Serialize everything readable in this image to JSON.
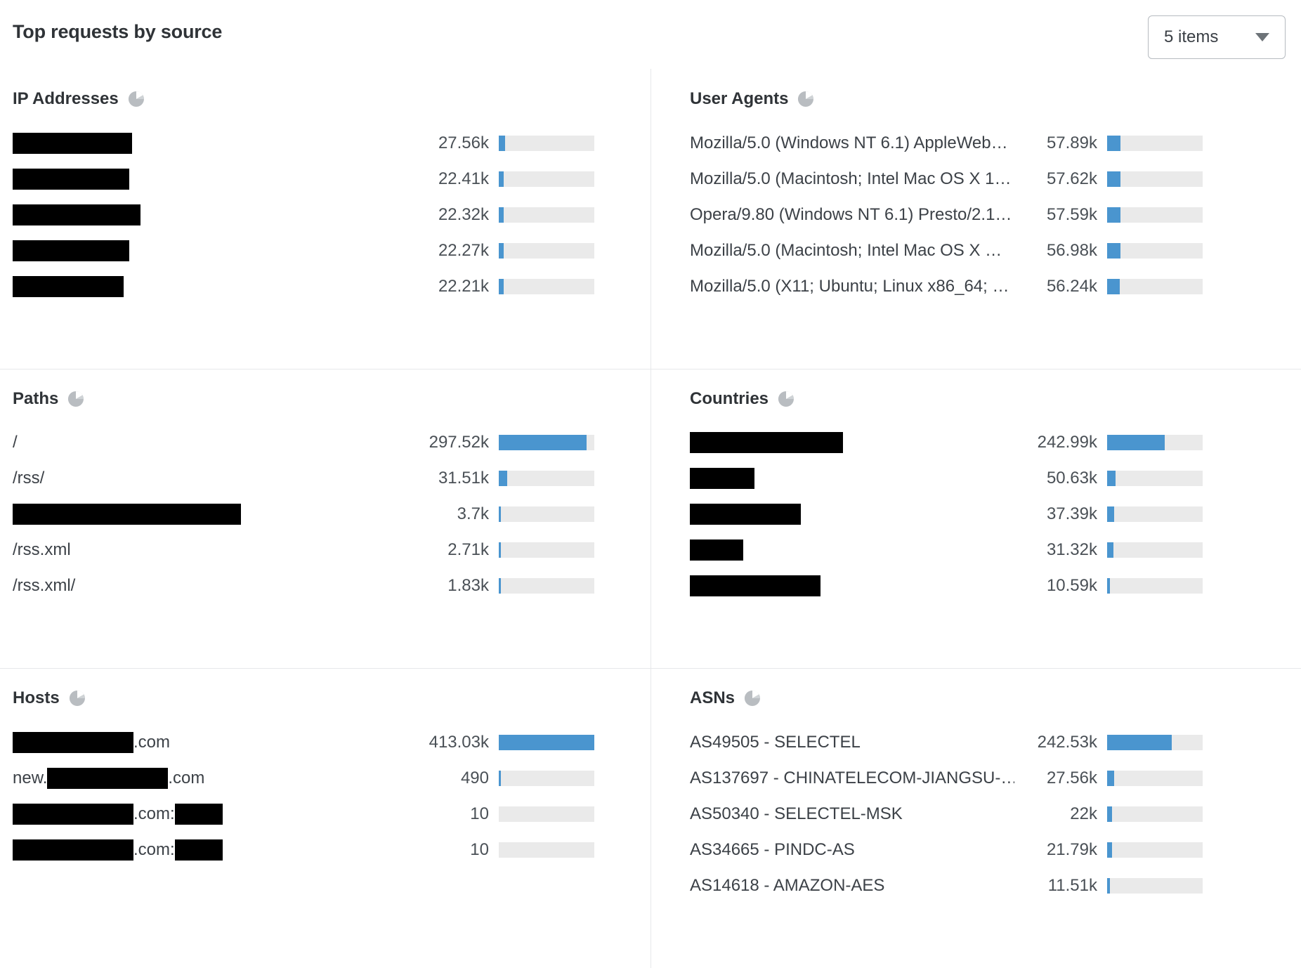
{
  "card": {
    "title": "Top requests by source",
    "items_select": {
      "value": "5 items",
      "caret_icon": "chevron-down-icon"
    }
  },
  "icons": {
    "section": "pie-chart-icon"
  },
  "colors": {
    "accent": "#4a95cf",
    "track": "#eaeaea",
    "redaction": "#000000",
    "text": "#3c4147"
  },
  "chart_data": [
    {
      "type": "bar",
      "title": "IP Addresses",
      "orientation": "horizontal",
      "categories": [
        "[redacted]",
        "[redacted]",
        "[redacted]",
        "[redacted]",
        "[redacted]"
      ],
      "redacted": [
        true,
        true,
        true,
        true,
        true
      ],
      "redact_widths": [
        170,
        166,
        182,
        166,
        158
      ],
      "value_labels": [
        "27.56k",
        "22.41k",
        "22.32k",
        "22.27k",
        "22.21k"
      ],
      "values": [
        27560,
        22410,
        22320,
        22270,
        22210
      ],
      "bar_pct": [
        6.7,
        5.4,
        5.4,
        5.4,
        5.4
      ],
      "xlabel": "",
      "ylabel": "",
      "grid": false,
      "legend": "none"
    },
    {
      "type": "bar",
      "title": "User Agents",
      "orientation": "horizontal",
      "categories": [
        "Mozilla/5.0 (Windows NT 6.1) AppleWeb…",
        "Mozilla/5.0 (Macintosh; Intel Mac OS X 1…",
        "Opera/9.80 (Windows NT 6.1) Presto/2.1…",
        "Mozilla/5.0 (Macintosh; Intel Mac OS X …",
        "Mozilla/5.0 (X11; Ubuntu; Linux x86_64; …"
      ],
      "redacted": [
        false,
        false,
        false,
        false,
        false
      ],
      "value_labels": [
        "57.89k",
        "57.62k",
        "57.59k",
        "56.98k",
        "56.24k"
      ],
      "values": [
        57890,
        57620,
        57590,
        56980,
        56240
      ],
      "bar_pct": [
        14.0,
        14.0,
        14.0,
        13.8,
        13.6
      ],
      "xlabel": "",
      "ylabel": "",
      "grid": false,
      "legend": "none"
    },
    {
      "type": "bar",
      "title": "Paths",
      "orientation": "horizontal",
      "categories": [
        "/",
        "/rss/",
        "[redacted]",
        "/rss.xml",
        "/rss.xml/"
      ],
      "redacted": [
        false,
        false,
        true,
        false,
        false
      ],
      "redact_widths": [
        0,
        0,
        325,
        0,
        0
      ],
      "value_labels": [
        "297.52k",
        "31.51k",
        "3.7k",
        "2.71k",
        "1.83k"
      ],
      "values": [
        297520,
        31510,
        3700,
        2710,
        1830
      ],
      "bar_pct": [
        92.0,
        9.0,
        2.2,
        2.2,
        2.2
      ],
      "xlabel": "",
      "ylabel": "",
      "grid": false,
      "legend": "none"
    },
    {
      "type": "bar",
      "title": "Countries",
      "orientation": "horizontal",
      "categories": [
        "[redacted]",
        "[redacted]",
        "[redacted]",
        "[redacted]",
        "[redacted]"
      ],
      "redacted": [
        true,
        true,
        true,
        true,
        true
      ],
      "redact_widths": [
        218,
        92,
        158,
        76,
        186
      ],
      "value_labels": [
        "242.99k",
        "50.63k",
        "37.39k",
        "31.32k",
        "10.59k"
      ],
      "values": [
        242990,
        50630,
        37390,
        31320,
        10590
      ],
      "bar_pct": [
        60.0,
        9.0,
        7.5,
        6.5,
        2.6
      ],
      "xlabel": "",
      "ylabel": "",
      "grid": false,
      "legend": "none"
    },
    {
      "type": "bar",
      "title": "Hosts",
      "orientation": "horizontal",
      "categories": [
        "[redacted].com",
        "new.[redacted].com",
        "[redacted].com:[redacted]",
        "[redacted].com:[redacted]"
      ],
      "redacted": [
        true,
        true,
        true,
        true
      ],
      "value_labels": [
        "413.03k",
        "490",
        "10",
        "10"
      ],
      "values": [
        413030,
        490,
        10,
        10
      ],
      "bar_pct": [
        100.0,
        2.2,
        0,
        0
      ],
      "xlabel": "",
      "ylabel": "",
      "grid": false,
      "legend": "none"
    },
    {
      "type": "bar",
      "title": "ASNs",
      "orientation": "horizontal",
      "categories": [
        "AS49505 - SELECTEL",
        "AS137697 - CHINATELECOM-JIANGSU-…",
        "AS50340 - SELECTEL-MSK",
        "AS34665 - PINDC-AS",
        "AS14618 - AMAZON-AES"
      ],
      "redacted": [
        false,
        false,
        false,
        false,
        false
      ],
      "value_labels": [
        "242.53k",
        "27.56k",
        "22k",
        "21.79k",
        "11.51k"
      ],
      "values": [
        242530,
        27560,
        22000,
        21790,
        11510
      ],
      "bar_pct": [
        68.0,
        7.0,
        5.5,
        5.5,
        2.6
      ],
      "xlabel": "",
      "ylabel": "",
      "grid": false,
      "legend": "none"
    }
  ]
}
